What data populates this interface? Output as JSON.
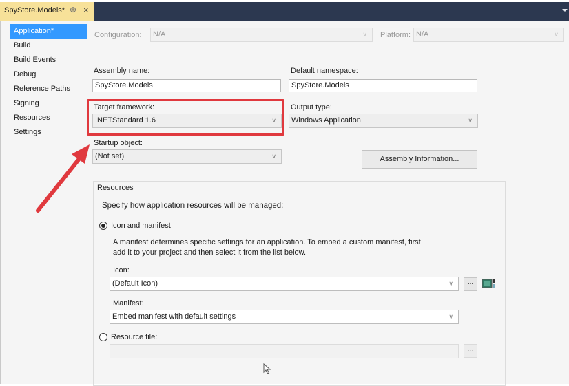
{
  "tab": {
    "title": "SpyStore.Models*",
    "pin_glyph": "⊕",
    "close_glyph": "×"
  },
  "nav": {
    "items": [
      {
        "label": "Application*",
        "active": true
      },
      {
        "label": "Build"
      },
      {
        "label": "Build Events"
      },
      {
        "label": "Debug"
      },
      {
        "label": "Reference Paths"
      },
      {
        "label": "Signing"
      },
      {
        "label": "Resources"
      },
      {
        "label": "Settings"
      }
    ]
  },
  "config": {
    "configuration_label": "Configuration:",
    "configuration_value": "N/A",
    "platform_label": "Platform:",
    "platform_value": "N/A"
  },
  "assembly": {
    "name_label": "Assembly name:",
    "name_value": "SpyStore.Models"
  },
  "namespace": {
    "label": "Default namespace:",
    "value": "SpyStore.Models"
  },
  "target_framework": {
    "label": "Target framework:",
    "value": ".NETStandard 1.6"
  },
  "output_type": {
    "label": "Output type:",
    "value": "Windows Application"
  },
  "startup": {
    "label": "Startup object:",
    "value": "(Not set)"
  },
  "assembly_info_button": "Assembly Information...",
  "resources": {
    "title": "Resources",
    "description": "Specify how application resources will be managed:",
    "icon_manifest_option": "Icon and manifest",
    "manifest_help_line1": "A manifest determines specific settings for an application. To embed a custom manifest, first",
    "manifest_help_line2": "add it to your project and then select it from the list below.",
    "icon_label": "Icon:",
    "icon_value": "(Default Icon)",
    "manifest_label": "Manifest:",
    "manifest_value": "Embed manifest with default settings",
    "resource_file_option": "Resource file:",
    "browse_glyph": "..."
  },
  "colors": {
    "tab_active": "#f7e199",
    "tab_bar": "#2c3850",
    "nav_selected": "#3399ff",
    "highlight": "#e0393e"
  }
}
